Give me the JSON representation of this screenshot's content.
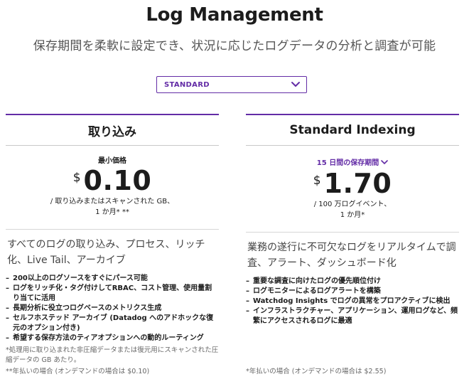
{
  "header": {
    "title": "Log Management",
    "subtitle": "保存期間を柔軟に設定でき、状況に応じたログデータの分析と調査が可能"
  },
  "plan_select": {
    "selected": "STANDARD",
    "icon": "chevron-down-icon"
  },
  "colors": {
    "accent": "#632ca6",
    "text": "#1c1c1c",
    "muted": "#666666"
  },
  "ingest": {
    "title": "取り込み",
    "price_label": "最小価格",
    "currency": "$",
    "price": "0.10",
    "unit_line1": "/ 取り込みまたはスキャンされた GB、",
    "unit_line2": "1 か月* **",
    "description": "すべてのログの取り込み、プロセス、リッチ化、Live Tail、アーカイブ",
    "features": [
      "200以上のログソースをすぐにパース可能",
      "ログをリッチ化・タグ付けしてRBAC、コスト管理、使用量割り当てに活用",
      "長期分析に役立つログベースのメトリクス生成",
      "セルフホステッド アーカイブ (Datadog へのアドホックな復元のオプション付き)",
      "希望する保存方法のティアオプションへの動的ルーティング"
    ],
    "footnote1": "*処理用に取り込まれた非圧縮データまたは復元用にスキャンされた圧縮データの GB あたり。",
    "footnote2": "**年払いの場合 (オンデマンドの場合は $0.10)"
  },
  "indexing": {
    "title": "Standard Indexing",
    "retention_label": "15 日間の保存期間",
    "currency": "$",
    "price": "1.70",
    "unit_line1": "/ 100 万ログイベント、",
    "unit_line2": "1 か月*",
    "description": "業務の遂行に不可欠なログをリアルタイムで調査、アラート、ダッシュボード化",
    "features": [
      "重要な調査に向けたログの優先順位付け",
      "ログモニターによるログアラートを構築",
      "Watchdog Insights でログの異常をプロアクティブに検出",
      "インフラストラクチャー、アプリケーション、運用ログなど、頻繁にアクセスされるログに最適"
    ],
    "footnote": "*年払いの場合 (オンデマンドの場合は $2.55)"
  }
}
